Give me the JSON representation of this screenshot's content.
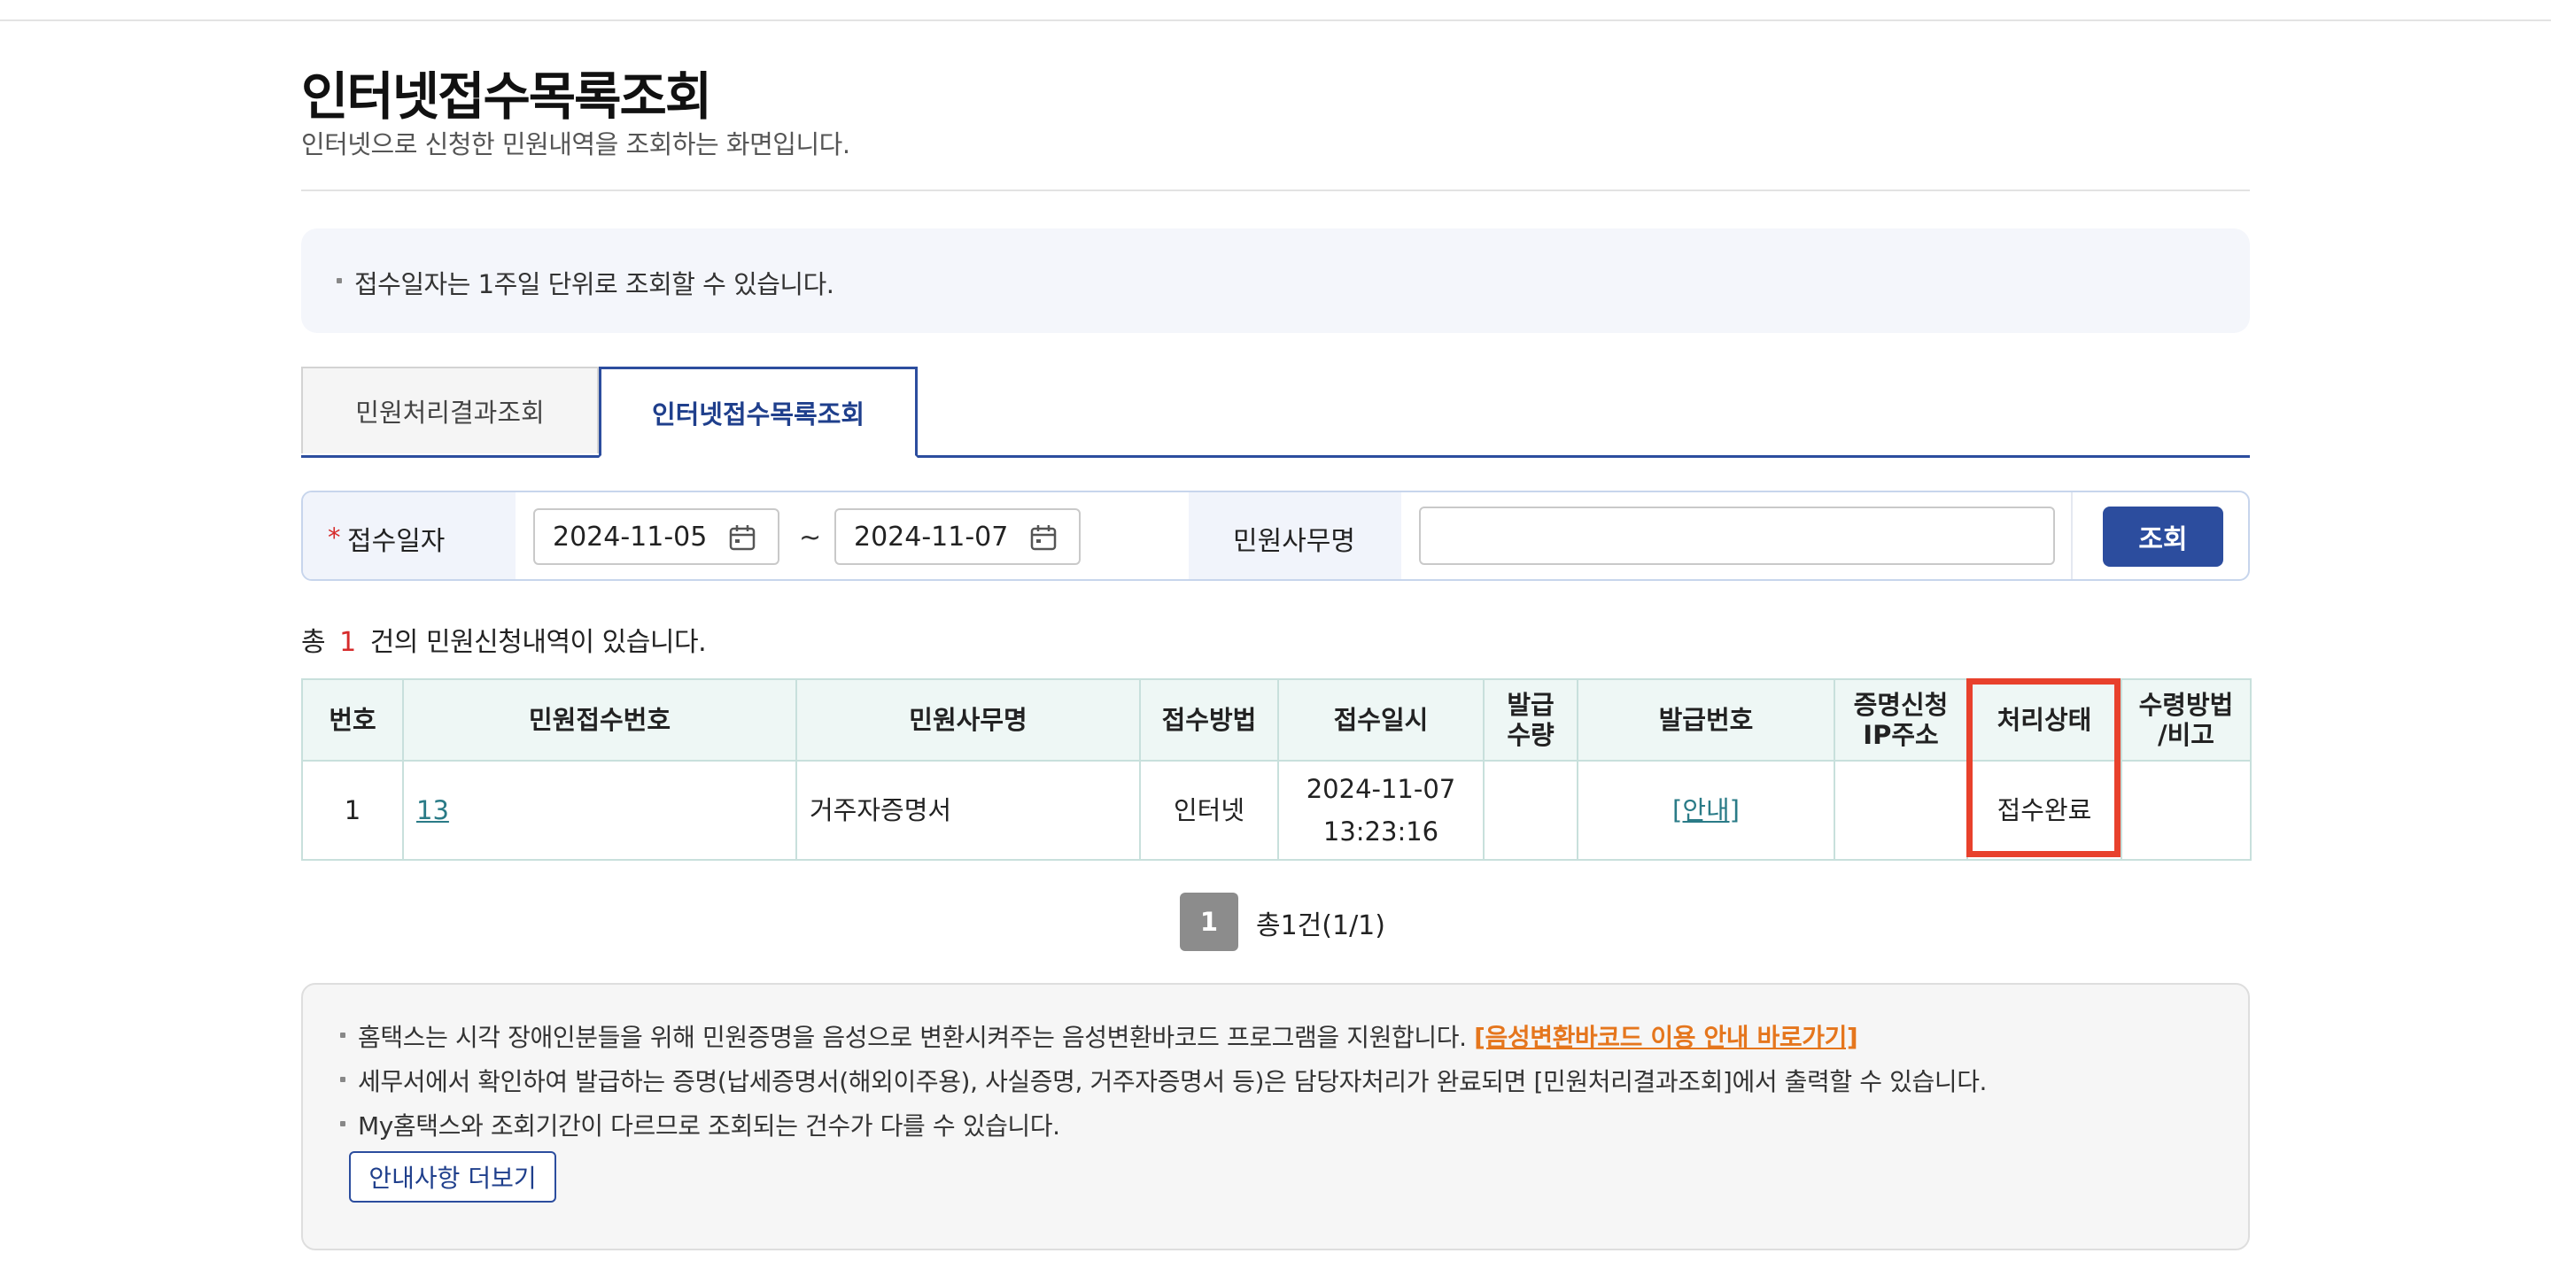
{
  "page": {
    "title": "인터넷접수목록조회",
    "subtitle": "인터넷으로 신청한 민원내역을 조회하는 화면입니다."
  },
  "notice": "접수일자는 1주일 단위로 조회할 수 있습니다.",
  "tabs": [
    {
      "label": "민원처리결과조회",
      "active": false
    },
    {
      "label": "인터넷접수목록조회",
      "active": true
    }
  ],
  "search": {
    "date_label": "접수일자",
    "required_mark": "*",
    "date_from": "2024-11-05",
    "date_to": "2024-11-07",
    "separator": "~",
    "name_label": "민원사무명",
    "name_value": "",
    "submit_label": "조회"
  },
  "summary": {
    "prefix": "총",
    "count": "1",
    "suffix": "건의 민원신청내역이 있습니다."
  },
  "table": {
    "headers": {
      "no": "번호",
      "receipt_no": "민원접수번호",
      "service_name": "민원사무명",
      "method": "접수방법",
      "received_at": "접수일시",
      "qty_1": "발급",
      "qty_2": "수량",
      "issue_no": "발급번호",
      "ip_1": "증명신청",
      "ip_2": "IP주소",
      "status": "처리상태",
      "receive_1": "수령방법",
      "receive_2": "/비고"
    },
    "rows": [
      {
        "no": "1",
        "receipt_no": "13",
        "service_name": "거주자증명서",
        "method": "인터넷",
        "date": "2024-11-07",
        "time": "13:23:16",
        "qty": "",
        "issue_no": "[안내]",
        "ip": "",
        "status": "접수완료",
        "receive": ""
      }
    ]
  },
  "pagination": {
    "current": "1",
    "summary": "총1건(1/1)"
  },
  "info": {
    "line1": "홈택스는 시각 장애인분들을 위해 민원증명을 음성으로 변환시켜주는 음성변환바코드 프로그램을 지원합니다.",
    "line1_link": "[음성변환바코드 이용 안내 바로가기]",
    "line2": "세무서에서 확인하여 발급하는 증명(납세증명서(해외이주용), 사실증명, 거주자증명서 등)은 담당자처리가 완료되면 [민원처리결과조회]에서 출력할 수 있습니다.",
    "line3": "My홈택스와 조회기간이 다르므로 조회되는 건수가 다를 수 있습니다.",
    "more_button": "안내사항 더보기"
  },
  "colors": {
    "primary": "#2c4d9e",
    "accent_red": "#d62b2b",
    "highlight": "#e8412c",
    "link_teal": "#2a7b87",
    "link_orange": "#e5761d"
  }
}
